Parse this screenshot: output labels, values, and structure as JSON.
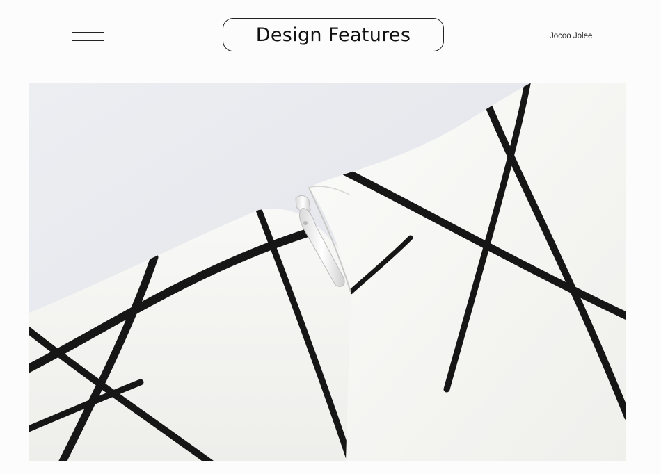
{
  "header": {
    "title": "Design Features",
    "brand": "Jocoo Jolee",
    "menu_icon": "menu-lines-icon"
  },
  "photo": {
    "subject": "dress-zipper-photo"
  },
  "colors": {
    "background": "#fdfcfd",
    "text": "#111111",
    "fabric": "#f5f5f3",
    "stripe": "#161616"
  }
}
